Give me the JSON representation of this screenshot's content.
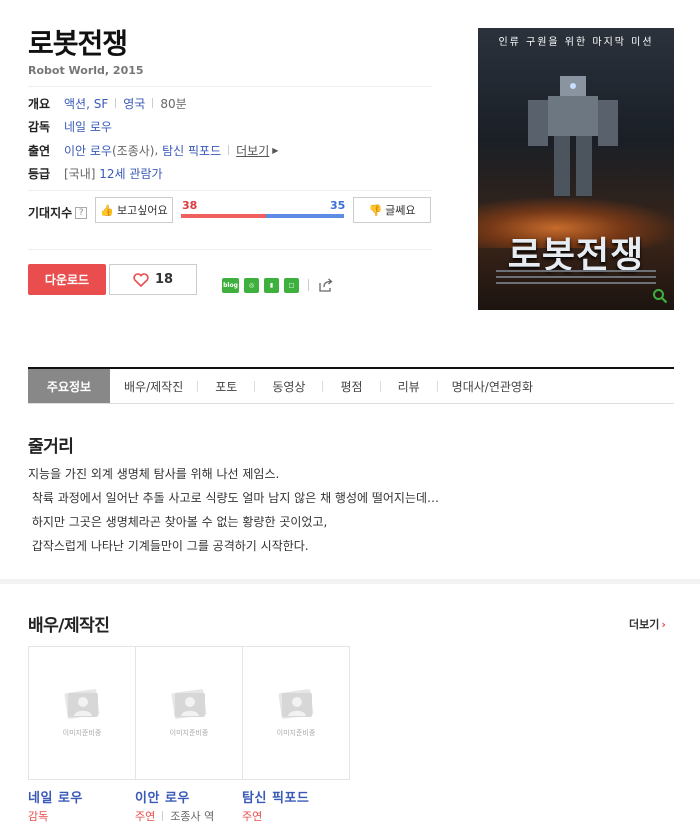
{
  "movie": {
    "title": "로봇전쟁",
    "subtitle": "Robot World, 2015"
  },
  "info": {
    "overview_label": "개요",
    "genre": "액션, SF",
    "country": "영국",
    "runtime": "80분",
    "director_label": "감독",
    "director": "네일 로우",
    "cast_label": "출연",
    "cast1_name": "이안 로우",
    "cast1_role": "(조종사)",
    "cast2_name": "탐신 픽포드",
    "cast_more": "더보기",
    "rating_label": "등급",
    "rating_prefix": "[국내]",
    "rating": "12세 관람가"
  },
  "expectation": {
    "label": "기대지수",
    "help": "?",
    "like_label": "보고싶어요",
    "dislike_label": "글쎄요",
    "like_count": "38",
    "dislike_count": "35",
    "like_ratio": 0.52
  },
  "actions": {
    "download": "다운로드",
    "heart_count": "18"
  },
  "share": {
    "blog": "blog"
  },
  "poster": {
    "tagline": "인류 구원을 위한 마지막 미션",
    "title": "로봇전쟁"
  },
  "tabs": [
    "주요정보",
    "배우/제작진",
    "포토",
    "동영상",
    "평점",
    "리뷰",
    "명대사/연관영화"
  ],
  "synopsis": {
    "heading": "줄거리",
    "lines": [
      "지능을 가진 외계 생명체 탐사를 위해 나선 제임스.",
      " 착륙 과정에서 일어난 추돌 사고로 식량도 얼마 남지 않은 채 행성에 떨어지는데…",
      " 하지만 그곳은 생명체라곤 찾아볼 수 없는 황량한 곳이었고,",
      " 갑작스럽게 나타난 기계들만이 그를 공격하기 시작한다."
    ]
  },
  "crew": {
    "heading": "배우/제작진",
    "more": "더보기",
    "placeholder": "이미지준비중",
    "people": [
      {
        "name": "네일 로우",
        "role": "감독",
        "character": ""
      },
      {
        "name": "이안 로우",
        "role": "주연",
        "character": "조종사 역"
      },
      {
        "name": "탐신 픽포드",
        "role": "주연",
        "character": ""
      }
    ]
  },
  "colors": {
    "accent_red": "#e94d4d",
    "link_blue": "#3a5ab8",
    "dislike_blue": "#3b6fd8",
    "share_green": "#3db03d"
  }
}
